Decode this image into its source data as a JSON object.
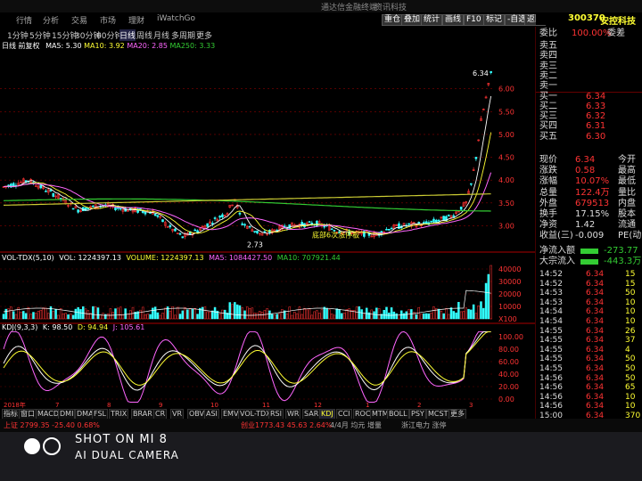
{
  "window": {
    "title": "通达信金融终端",
    "code_search": "资讯科技"
  },
  "top_menu": [
    "行情",
    "分析",
    "交易",
    "市场",
    "理财",
    "iWatchGo"
  ],
  "toolbar": [
    "重仓",
    "叠加",
    "统计",
    "画线",
    "F10",
    "标记",
    "-自选",
    "返回"
  ],
  "periods": [
    "1分钟",
    "5分钟",
    "15分钟",
    "30分钟",
    "60分钟",
    "日线",
    "周线",
    "月线",
    "多周期",
    "更多"
  ],
  "main_header": {
    "label": "日线 前复权",
    "ma5": "MA5: 5.30",
    "ma10": "MA10: 3.92",
    "ma20": "MA20: 2.85",
    "ma250": "MA250: 3.33"
  },
  "main_labels": {
    "high": "6.34",
    "low": "2.73",
    "annotation": "底部6次涨停板"
  },
  "price_axis": [
    "6.00",
    "5.50",
    "5.00",
    "4.50",
    "4.00",
    "3.50",
    "3.00"
  ],
  "vol_header": {
    "name": "VOL-TDX(5,10)",
    "vol": "VOL: 1224397.13",
    "volume": "VOLUME: 1224397.13",
    "ma5": "MA5: 1084427.50",
    "ma10": "MA10: 707921.44"
  },
  "vol_axis": [
    "40000",
    "30000",
    "20000",
    "10000",
    "X100"
  ],
  "kdj_header": {
    "name": "KDJ(9,3,3)",
    "k": "K: 98.50",
    "d": "D: 94.94",
    "j": "J: 105.61"
  },
  "kdj_axis": [
    "100.00",
    "80.00",
    "60.00",
    "40.00",
    "20.00",
    "0.00"
  ],
  "kdj_dates": [
    "2018年",
    "7",
    "8",
    "9",
    "10",
    "11",
    "12",
    "1",
    "2",
    "3"
  ],
  "indicators": [
    "指标",
    "窗口",
    "MACD",
    "DMI",
    "DMA",
    "FSL",
    "TRIX",
    "BRAR",
    "CR",
    "VR",
    "OBV",
    "ASI",
    "EMV",
    "VOL-TDX",
    "RSI",
    "WR",
    "SAR",
    "KDJ",
    "CCI",
    "ROC",
    "MTM",
    "BOLL",
    "PSY",
    "MCST",
    "更多"
  ],
  "status": {
    "left": "上证 2799.35 -25.40 0.68%",
    "mid": "创业1773.43 45.63 2.64%",
    "right": "4/4月 均元 增量",
    "news": "浙江电力 涨停"
  },
  "stock": {
    "code": "300370",
    "name": "安控科技",
    "weibi_label": "委比",
    "weibi": "100.00%",
    "weicha_label": "委差"
  },
  "order_book": [
    {
      "label": "卖五",
      "price": "",
      "vol": ""
    },
    {
      "label": "卖四",
      "price": "",
      "vol": ""
    },
    {
      "label": "卖三",
      "price": "",
      "vol": ""
    },
    {
      "label": "卖二",
      "price": "",
      "vol": ""
    },
    {
      "label": "卖一",
      "price": "",
      "vol": ""
    },
    {
      "label": "买一",
      "price": "6.34",
      "vol": ""
    },
    {
      "label": "买二",
      "price": "6.33",
      "vol": ""
    },
    {
      "label": "买三",
      "price": "6.32",
      "vol": ""
    },
    {
      "label": "买四",
      "price": "6.31",
      "vol": ""
    },
    {
      "label": "买五",
      "price": "6.30",
      "vol": ""
    }
  ],
  "quote": [
    {
      "l": "现价",
      "v": "6.34",
      "r": "今开"
    },
    {
      "l": "涨跌",
      "v": "0.58",
      "r": "最高"
    },
    {
      "l": "涨幅",
      "v": "10.07%",
      "r": "最低"
    },
    {
      "l": "总量",
      "v": "122.4万",
      "r": "量比"
    },
    {
      "l": "外盘",
      "v": "679513",
      "r": "内盘"
    },
    {
      "l": "换手",
      "v": "17.15%",
      "r": "股本"
    },
    {
      "l": "净资",
      "v": "1.42",
      "r": "流通"
    },
    {
      "l": "收益(三)",
      "v": "-0.009",
      "r": "PE(动)"
    }
  ],
  "flow": [
    {
      "l": "净流入额",
      "v": "-273.77"
    },
    {
      "l": "大宗流入",
      "v": "-443.3万"
    }
  ],
  "ticks": [
    {
      "t": "14:52",
      "p": "6.34",
      "v": "15"
    },
    {
      "t": "14:52",
      "p": "6.34",
      "v": "15"
    },
    {
      "t": "14:53",
      "p": "6.34",
      "v": "50"
    },
    {
      "t": "14:53",
      "p": "6.34",
      "v": "10"
    },
    {
      "t": "14:54",
      "p": "6.34",
      "v": "10"
    },
    {
      "t": "14:54",
      "p": "6.34",
      "v": "10"
    },
    {
      "t": "14:55",
      "p": "6.34",
      "v": "26"
    },
    {
      "t": "14:55",
      "p": "6.34",
      "v": "37"
    },
    {
      "t": "14:55",
      "p": "6.34",
      "v": "4"
    },
    {
      "t": "14:55",
      "p": "6.34",
      "v": "50"
    },
    {
      "t": "14:55",
      "p": "6.34",
      "v": "50"
    },
    {
      "t": "14:56",
      "p": "6.34",
      "v": "50"
    },
    {
      "t": "14:56",
      "p": "6.34",
      "v": "65"
    },
    {
      "t": "14:56",
      "p": "6.34",
      "v": "10"
    },
    {
      "t": "14:56",
      "p": "6.34",
      "v": "10"
    },
    {
      "t": "15:00",
      "p": "6.34",
      "v": "370"
    }
  ],
  "watermark": {
    "line1": "SHOT ON MI 8",
    "line2": "AI DUAL CAMERA"
  },
  "colors": {
    "up": "#ff3333",
    "down": "#33ffff",
    "ma5": "#ffffff",
    "ma10": "#ffff33",
    "ma20": "#ff66ff",
    "ma250": "#33cc33",
    "accent": "#ffcc00"
  }
}
